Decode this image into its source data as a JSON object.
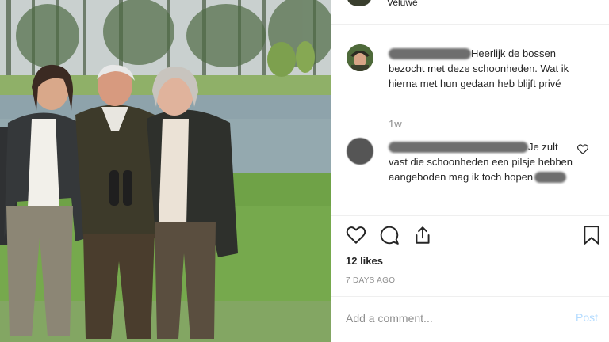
{
  "header": {
    "location": "Veluwe"
  },
  "post": {
    "caption": "Heerlijk de bossen bezocht met deze schoonheden. Wat ik hierna met hun gedaan heb blijft privé",
    "time_ago": "1w"
  },
  "comment": {
    "text": "Je zult vast die schoonheden een pilsje hebben aangeboden mag ik toch hopen"
  },
  "actions": {
    "icons": [
      "heart-icon",
      "comment-icon",
      "share-icon",
      "bookmark-icon"
    ]
  },
  "likes": "12 likes",
  "date": "7 DAYS AGO",
  "add_comment": {
    "placeholder": "Add a comment...",
    "post_label": "Post"
  },
  "colors": {
    "post_button": "#b3dbff",
    "muted_text": "#8e8e8e",
    "divider": "#efefef"
  }
}
